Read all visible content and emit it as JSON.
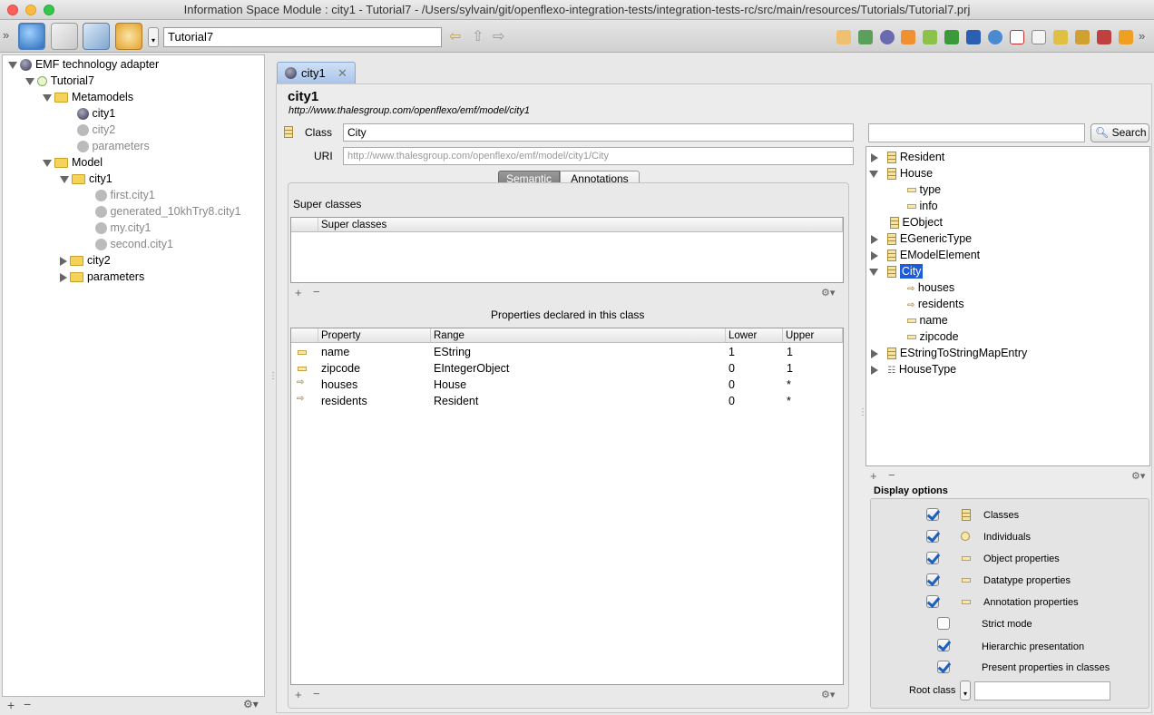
{
  "window": {
    "title": "Information Space Module : city1 - Tutorial7 - /Users/sylvain/git/openflexo-integration-tests/integration-tests-rc/src/main/resources/Tutorials/Tutorial7.prj"
  },
  "toolbar": {
    "project": "Tutorial7"
  },
  "tree": {
    "root": "EMF technology adapter",
    "project": "Tutorial7",
    "metamodels": "Metamodels",
    "mm_items": [
      "city1",
      "city2",
      "parameters"
    ],
    "model": "Model",
    "model_city1": "city1",
    "model_city1_items": [
      "first.city1",
      "generated_10khTry8.city1",
      "my.city1",
      "second.city1"
    ],
    "model_city2": "city2",
    "model_params": "parameters"
  },
  "editor": {
    "tab_label": "city1",
    "title": "city1",
    "uri_subtitle": "http://www.thalesgroup.com/openflexo/emf/model/city1",
    "class_label": "Class",
    "class_value": "City",
    "uri_label": "URI",
    "uri_value": "http://www.thalesgroup.com/openflexo/emf/model/city1/City",
    "tab_semantic": "Semantic",
    "tab_annotations": "Annotations",
    "super_classes_title": "Super classes",
    "super_classes_header": "Super classes",
    "properties_title": "Properties declared in this class",
    "prop_headers": {
      "property": "Property",
      "range": "Range",
      "lower": "Lower",
      "upper": "Upper"
    },
    "properties": [
      {
        "name": "name",
        "range": "EString",
        "lower": "1",
        "upper": "1",
        "kind": "data"
      },
      {
        "name": "zipcode",
        "range": "EIntegerObject",
        "lower": "0",
        "upper": "1",
        "kind": "data"
      },
      {
        "name": "houses",
        "range": "House",
        "lower": "0",
        "upper": "*",
        "kind": "object"
      },
      {
        "name": "residents",
        "range": "Resident",
        "lower": "0",
        "upper": "*",
        "kind": "object"
      }
    ]
  },
  "browser": {
    "search_placeholder": "",
    "search_button": "Search",
    "items": [
      "Resident",
      "House",
      "type",
      "info",
      "EObject",
      "EGenericType",
      "EModelElement",
      "City",
      "houses",
      "residents",
      "name",
      "zipcode",
      "EStringToStringMapEntry",
      "HouseType"
    ],
    "display_options_title": "Display options",
    "options": [
      "Classes",
      "Individuals",
      "Object properties",
      "Datatype properties",
      "Annotation properties",
      "Strict mode",
      "Hierarchic presentation",
      "Present properties in classes"
    ],
    "options_checked": [
      true,
      true,
      true,
      true,
      true,
      false,
      true,
      true
    ],
    "root_class_label": "Root class",
    "root_class_value": ""
  },
  "colors": {
    "selection": "#1e5bd8",
    "tab": "#b8cff0",
    "accent_check": "#1c5fbf"
  }
}
